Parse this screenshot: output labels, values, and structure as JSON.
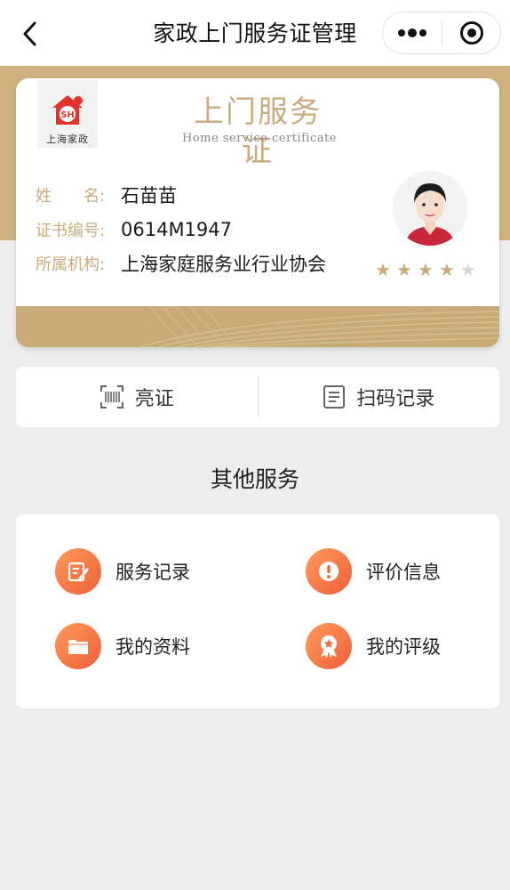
{
  "header": {
    "title": "家政上门服务证管理"
  },
  "certificate": {
    "logo_text": "上海家政",
    "logo_mark": "SH",
    "title": "上门服务证",
    "subtitle": "Home service certificate",
    "fields": [
      {
        "label": "姓　　名:",
        "value": "石苗苗"
      },
      {
        "label": "证书编号:",
        "value": "0614M1947"
      },
      {
        "label": "所属机构:",
        "value": "上海家庭服务业行业协会"
      }
    ],
    "rating": 4,
    "rating_max": 5
  },
  "actions": {
    "show_cert": "亮证",
    "scan_record": "扫码记录"
  },
  "other_services": {
    "title": "其他服务",
    "items": [
      {
        "label": "服务记录",
        "icon": "edit-icon"
      },
      {
        "label": "评价信息",
        "icon": "exclamation-icon"
      },
      {
        "label": "我的资料",
        "icon": "folder-icon"
      },
      {
        "label": "我的评级",
        "icon": "medal-icon"
      }
    ]
  },
  "colors": {
    "gold": "#c9ab7d",
    "orange": "#f06a3e"
  }
}
